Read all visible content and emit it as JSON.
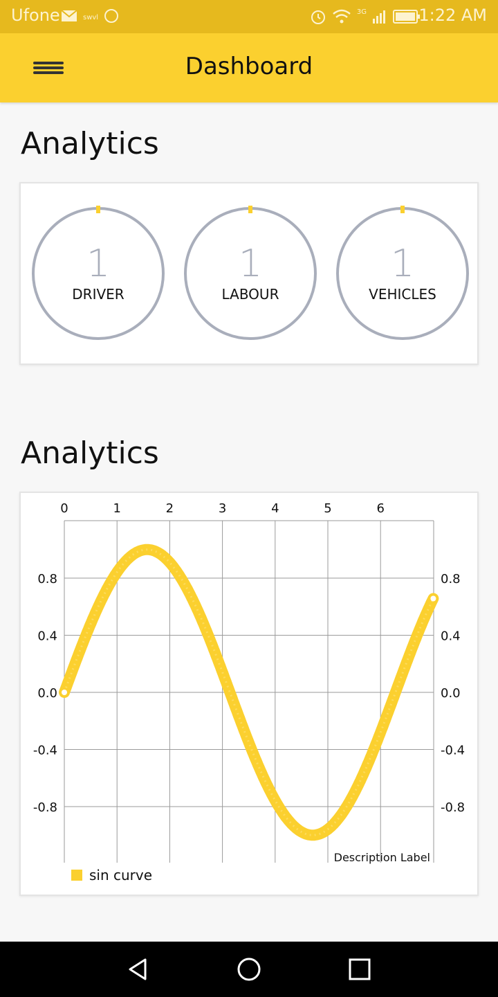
{
  "status_bar": {
    "carrier": "Ufone",
    "time": "1:22 AM",
    "network_type": "3G",
    "icons_left": [
      "mail-icon",
      "swvl-icon",
      "imo-icon"
    ],
    "icons_right": [
      "alarm-icon",
      "wifi-icon",
      "signal-icon",
      "battery-icon"
    ]
  },
  "app_bar": {
    "title": "Dashboard",
    "menu_icon": "hamburger-menu-icon"
  },
  "sections": {
    "summary_title": "Analytics",
    "chart_title": "Analytics"
  },
  "stats": [
    {
      "count": "1",
      "label": "DRIVER"
    },
    {
      "count": "1",
      "label": "LABOUR"
    },
    {
      "count": "1",
      "label": "VEHICLES"
    }
  ],
  "colors": {
    "accent": "#fbd02f",
    "status_bar": "#e6b91e",
    "ring": "#a9aebb",
    "series": "#fbd02f"
  },
  "chart_data": {
    "type": "line",
    "function": "sin",
    "x_range": [
      0,
      7
    ],
    "x_ticks": [
      "0",
      "1",
      "2",
      "3",
      "4",
      "5",
      "6"
    ],
    "y_range": [
      -1.0,
      1.0
    ],
    "y_ticks_left": [
      "0.8",
      "0.4",
      "0.0",
      "-0.4",
      "-0.8"
    ],
    "y_ticks_right": [
      "0.8",
      "0.4",
      "0.0",
      "-0.4",
      "-0.8"
    ],
    "x_axis_position": "top",
    "grid": true,
    "description": "Description Label",
    "legend_position": "bottom-left",
    "series": [
      {
        "name": "sin curve",
        "x_start": 0,
        "x_end": 7,
        "color": "#fbd02f"
      }
    ]
  },
  "nav_bar": {
    "back": "back-icon",
    "home": "home-icon",
    "recents": "recents-icon"
  }
}
